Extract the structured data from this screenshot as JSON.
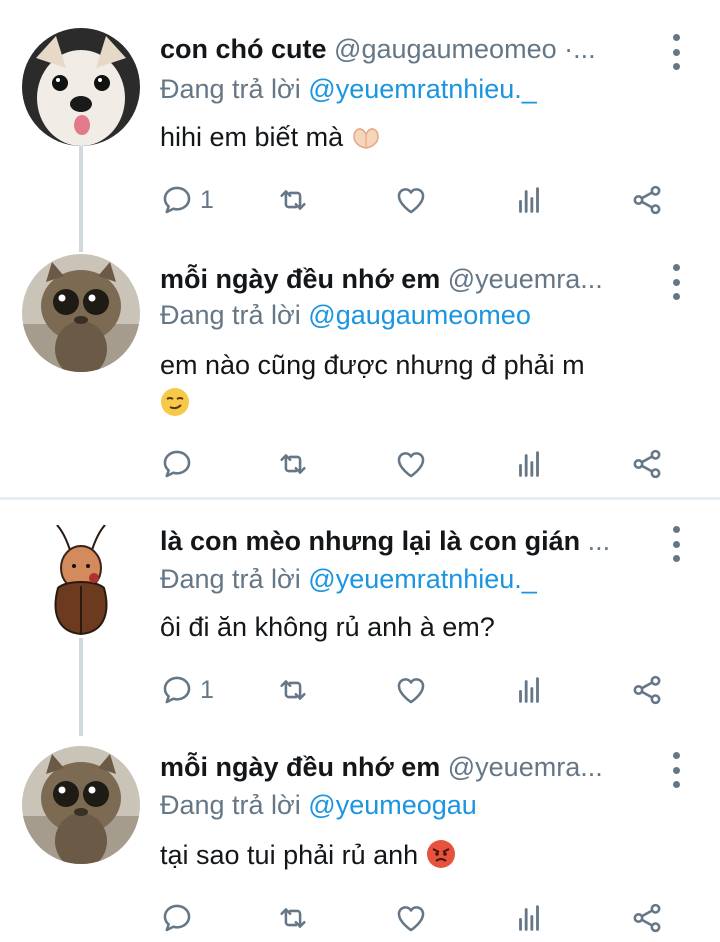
{
  "colors": {
    "name": "#14171a",
    "secondary": "#657786",
    "mention": "#1b95e0",
    "thread_line": "#cfd9de",
    "divider": "#e6ecf0"
  },
  "tweets": [
    {
      "display_name": "con chó cute",
      "handle": "@gaugaumeomeo ·...",
      "replying_label": "Đang trả lời",
      "replying_to": "@yeuemratnhieu._",
      "text": "hihi em biết mà",
      "emoji": "heart-hands-emoji",
      "reply_count": "1",
      "avatar": "dog-avatar"
    },
    {
      "display_name": "mỗi ngày đều nhớ em",
      "handle": "@yeuemra...",
      "replying_label": "Đang trả lời",
      "replying_to": "@gaugaumeomeo",
      "text": "em nào cũng được nhưng đ phải m",
      "emoji": "smirking-face-emoji",
      "reply_count": "",
      "avatar": "cat-avatar"
    },
    {
      "display_name": "là con mèo nhưng lại là con gián",
      "handle": "...",
      "replying_label": "Đang trả lời",
      "replying_to": "@yeuemratnhieu._",
      "text": "ôi đi ăn không rủ anh à em?",
      "emoji": "",
      "reply_count": "1",
      "avatar": "cockroach-avatar"
    },
    {
      "display_name": "mỗi ngày đều nhớ em",
      "handle": "@yeuemra...",
      "replying_label": "Đang trả lời",
      "replying_to": "@yeumeogau",
      "text": "tại sao tui phải rủ anh",
      "emoji": "angry-face-emoji",
      "reply_count": "",
      "avatar": "cat-avatar"
    }
  ]
}
